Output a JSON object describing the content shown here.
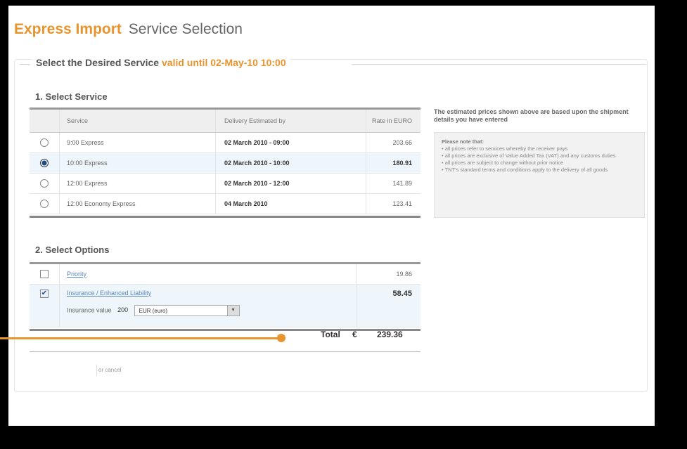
{
  "header": {
    "brand": "Express Import",
    "subtitle": "Service Selection"
  },
  "panel": {
    "legend": "Select the Desired Service",
    "validity": "valid until 02-May-10 10:00"
  },
  "select_service": {
    "heading": "1. Select Service",
    "columns": [
      "Service",
      "Delivery Estimated by",
      "Rate in EURO"
    ],
    "rows": [
      {
        "service": "9:00 Express",
        "delivery": "02 March 2010 - 09:00",
        "rate": "203.66",
        "selected": false
      },
      {
        "service": "10:00 Express",
        "delivery": "02 March 2010 - 10:00",
        "rate": "180.91",
        "selected": true
      },
      {
        "service": "12:00 Express",
        "delivery": "02 March 2010 - 12:00",
        "rate": "141.89",
        "selected": false
      },
      {
        "service": "12:00 Economy Express",
        "delivery": "04 March 2010",
        "rate": "123.41",
        "selected": false
      }
    ]
  },
  "select_options": {
    "heading": "2. Select Options",
    "priority": {
      "label": "Priority",
      "price": "19.86",
      "checked": false
    },
    "insurance": {
      "label": "Insurance / Enhanced Liability",
      "price": "58.45",
      "checked": true,
      "value_label": "Insurance value",
      "value": "200",
      "currency": "EUR (euro)"
    }
  },
  "total": {
    "label": "Total",
    "currency": "€",
    "amount": "239.36"
  },
  "note": {
    "heading": "The estimated prices shown above are based upon the shipment details you have entered",
    "box_title": "Please note that:",
    "items": [
      "all prices refer to services whereby the receiver pays",
      "all prices are exclusive of Value Added Tax (VAT) and any customs duties",
      "all prices are subject to change without prior notice",
      "TNT's standard terms and conditions apply to the delivery of all goods"
    ]
  },
  "footer": {
    "cancel": "or cancel"
  },
  "colors": {
    "accent": "#e8942e",
    "selected_row": "#eef5fb",
    "link": "#5b86b8"
  }
}
